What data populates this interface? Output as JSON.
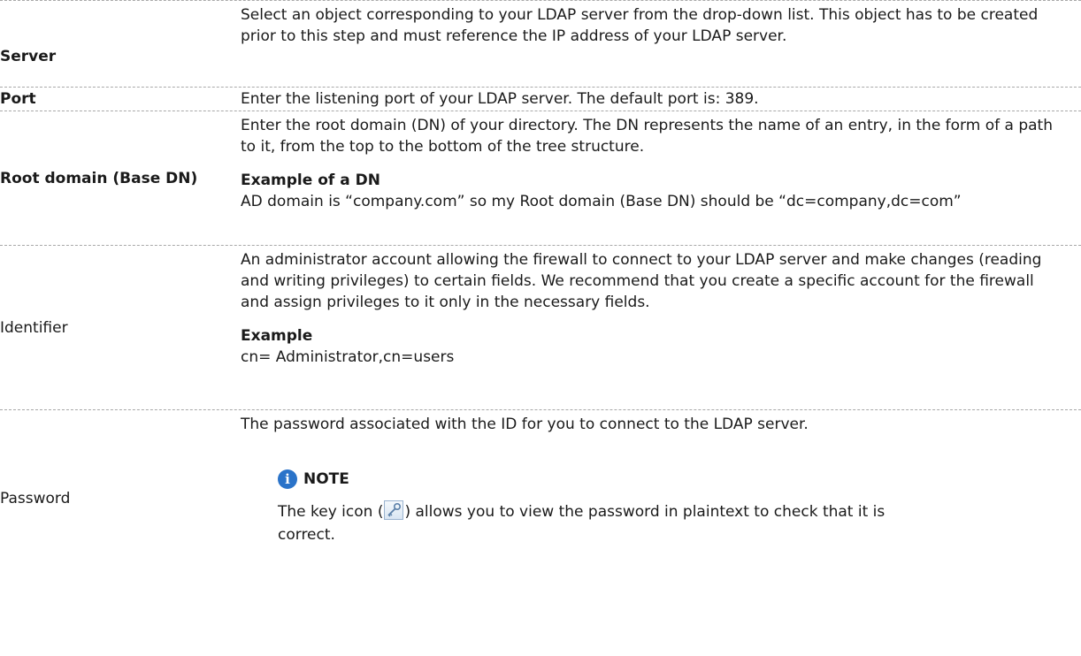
{
  "rows": {
    "server": {
      "label": "Server",
      "desc": "Select an object corresponding to your LDAP server from the drop-down list. This object has to be created prior to this step and must reference the IP address of your LDAP server."
    },
    "port": {
      "label": "Port",
      "desc": "Enter the listening port of your LDAP server. The default port is: 389."
    },
    "root_domain": {
      "label": "Root domain (Base DN)",
      "desc": "Enter the root domain (DN) of your directory. The DN represents the name of an entry, in the form of a path to it, from the top to the bottom of the tree structure.",
      "example_heading": "Example of a DN",
      "example_text": "AD domain is “company.com” so my Root domain (Base DN) should be “dc=company,dc=com”"
    },
    "identifier": {
      "label": "Identifier",
      "desc": "An administrator account allowing the firewall to connect to your LDAP server and make changes (reading and writing privileges) to certain fields. We recommend that you create a specific account for the firewall and assign privileges to it only in the necessary fields.",
      "example_heading": "Example",
      "example_text": "cn= Administrator,cn=users"
    },
    "password": {
      "label": "Password",
      "desc": "The password associated with the ID for you to connect to the LDAP server.",
      "note_title": "NOTE",
      "note_text_before": "The key icon (",
      "note_text_after": ") allows you to view the password in plaintext to check that it is correct."
    }
  },
  "icons": {
    "note": "info-icon",
    "key": "key-icon"
  },
  "colors": {
    "note_icon": "#2a73c9",
    "divider": "#a8a8a8"
  }
}
